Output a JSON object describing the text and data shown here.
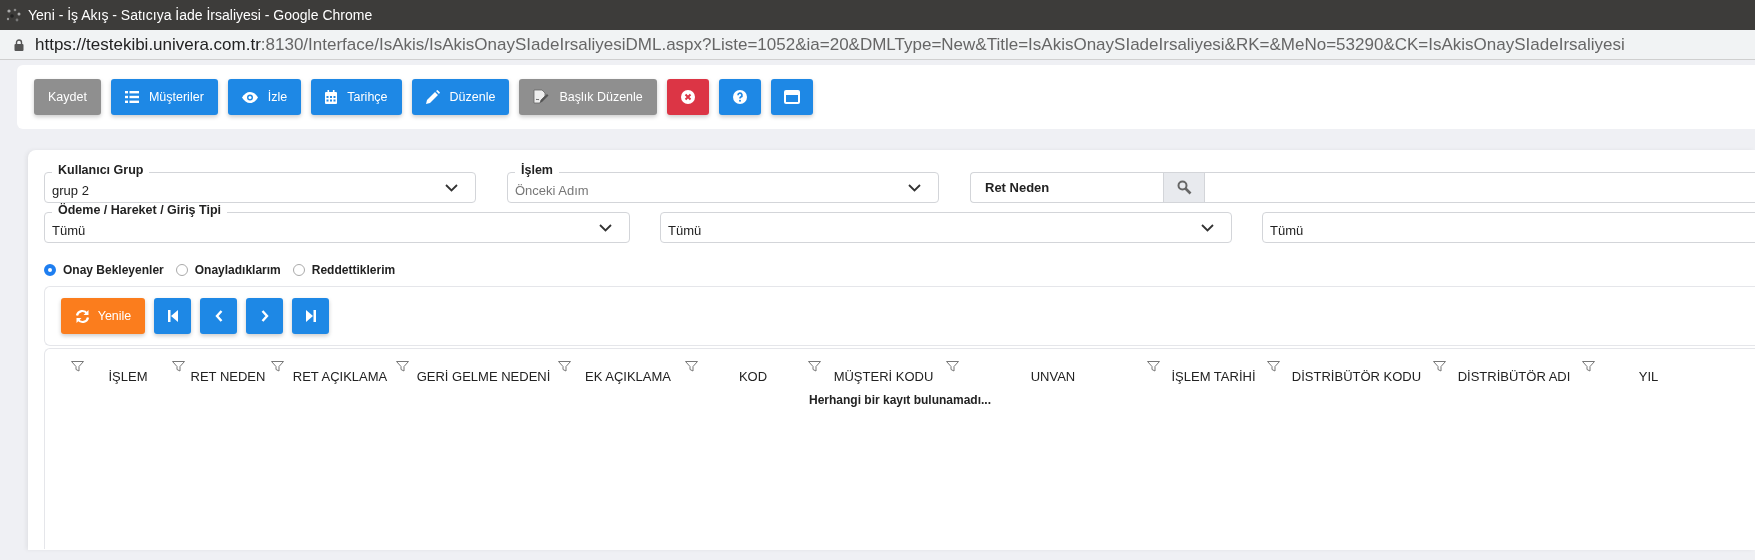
{
  "window": {
    "title": "Yeni - İş Akış - Satıcıya İade İrsaliyesi - Google Chrome"
  },
  "address_bar": {
    "host": "https://testekibi.univera.com.tr",
    "path": ":8130/Interface/IsAkis/IsAkisOnaySIadeIrsaliyesiDML.aspx?Liste=1052&ia=20&DMLType=New&Title=IsAkisOnaySIadeIrsaliyesi&RK=&MeNo=53290&CK=IsAkisOnaySIadeIrsaliyesi"
  },
  "toolbar": [
    {
      "label": "Kaydet",
      "kind": "save"
    },
    {
      "label": "Müşteriler",
      "kind": "list"
    },
    {
      "label": "İzle",
      "kind": "eye"
    },
    {
      "label": "Tarihçe",
      "kind": "calendar"
    },
    {
      "label": "Düzenle",
      "kind": "pencil"
    },
    {
      "label": "Başlık Düzenle",
      "kind": "edit-doc"
    },
    {
      "kind": "close"
    },
    {
      "kind": "help"
    },
    {
      "kind": "window"
    }
  ],
  "filters": {
    "row_1": [
      {
        "kind": "select",
        "label": "Kullanıcı Grup",
        "value": "grup 2"
      },
      {
        "kind": "select",
        "label": "İşlem",
        "placeholder": "Önceki Adım"
      },
      {
        "kind": "search",
        "label": "Ret Neden"
      }
    ],
    "row_2": [
      {
        "kind": "select",
        "label": "Ödeme / Hareket / Giriş Tipi",
        "value": "Tümü"
      },
      {
        "kind": "select",
        "value": "Tümü"
      },
      {
        "kind": "select",
        "value": "Tümü"
      }
    ]
  },
  "approval_filter": [
    {
      "label": "Onay Bekleyenler",
      "selected": true
    },
    {
      "label": "Onayladıklarım",
      "selected": false
    },
    {
      "label": "Reddettiklerim",
      "selected": false
    }
  ],
  "grid_toolbar": [
    {
      "label": "Yenile",
      "kind": "refresh"
    },
    {
      "kind": "first"
    },
    {
      "kind": "prev"
    },
    {
      "kind": "next"
    },
    {
      "kind": "last"
    }
  ],
  "table": {
    "columns": [
      "İŞLEM",
      "RET NEDEN",
      "RET AÇIKLAMA",
      "GERİ GELME NEDENİ",
      "EK AÇIKLAMA",
      "KOD",
      "MÜŞTERİ KODU",
      "UNVAN",
      "İŞLEM TARİHİ",
      "DİSTRİBÜTÖR KODU",
      "DİSTRİBÜTÖR ADI",
      "YIL"
    ],
    "empty_message": "Herhangi bir kayıt bulunamadı..."
  }
}
